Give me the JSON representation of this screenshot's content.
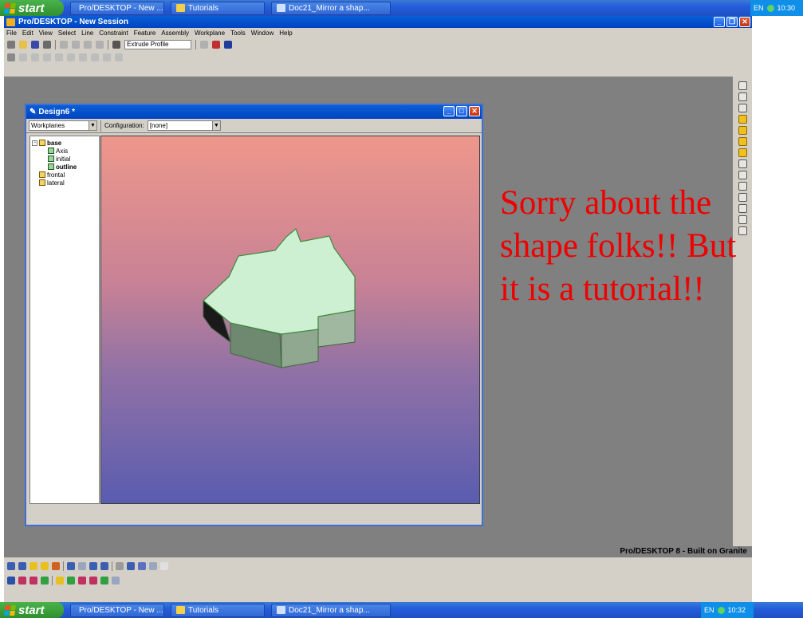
{
  "taskbar": {
    "start_label": "start",
    "top_tasks": [
      "Pro/DESKTOP - New ...",
      "Tutorials",
      "Doc21_Mirror a shap..."
    ],
    "bottom_tasks": [
      "Pro/DESKTOP - New ...",
      "Tutorials",
      "Doc21_Mirror a shap..."
    ],
    "top_lang": "EN",
    "top_time": "10:30",
    "bottom_lang": "EN",
    "bottom_time": "10:32"
  },
  "app": {
    "title": "Pro/DESKTOP - New Session",
    "menu": [
      "File",
      "Edit",
      "View",
      "Select",
      "Line",
      "Constraint",
      "Feature",
      "Assembly",
      "Workplane",
      "Tools",
      "Window",
      "Help"
    ],
    "undo_field": "Extrude Profile",
    "status_text": "Pro/DESKTOP 8 - Built on Granite"
  },
  "design_window": {
    "title": "Design6 *",
    "workplanes_select": "Workplanes",
    "configuration_label": "Configuration:",
    "configuration_value": "[none]",
    "tree": [
      {
        "label": "base",
        "bold": true,
        "level": 0,
        "toggle": "−"
      },
      {
        "label": "Axis",
        "bold": false,
        "level": 1
      },
      {
        "label": "initial",
        "bold": false,
        "level": 1
      },
      {
        "label": "outline",
        "bold": true,
        "level": 1
      },
      {
        "label": "frontal",
        "bold": false,
        "level": 0
      },
      {
        "label": "lateral",
        "bold": false,
        "level": 0
      }
    ]
  },
  "overlay_note": "Sorry about the shape folks!! But it is a tutorial!!",
  "colors": {
    "xp_blue": "#245edb",
    "view_top": "#ee978b",
    "view_bottom": "#5a5cb0",
    "shape_top": "#cdefd2",
    "note_red": "#ee0000"
  }
}
